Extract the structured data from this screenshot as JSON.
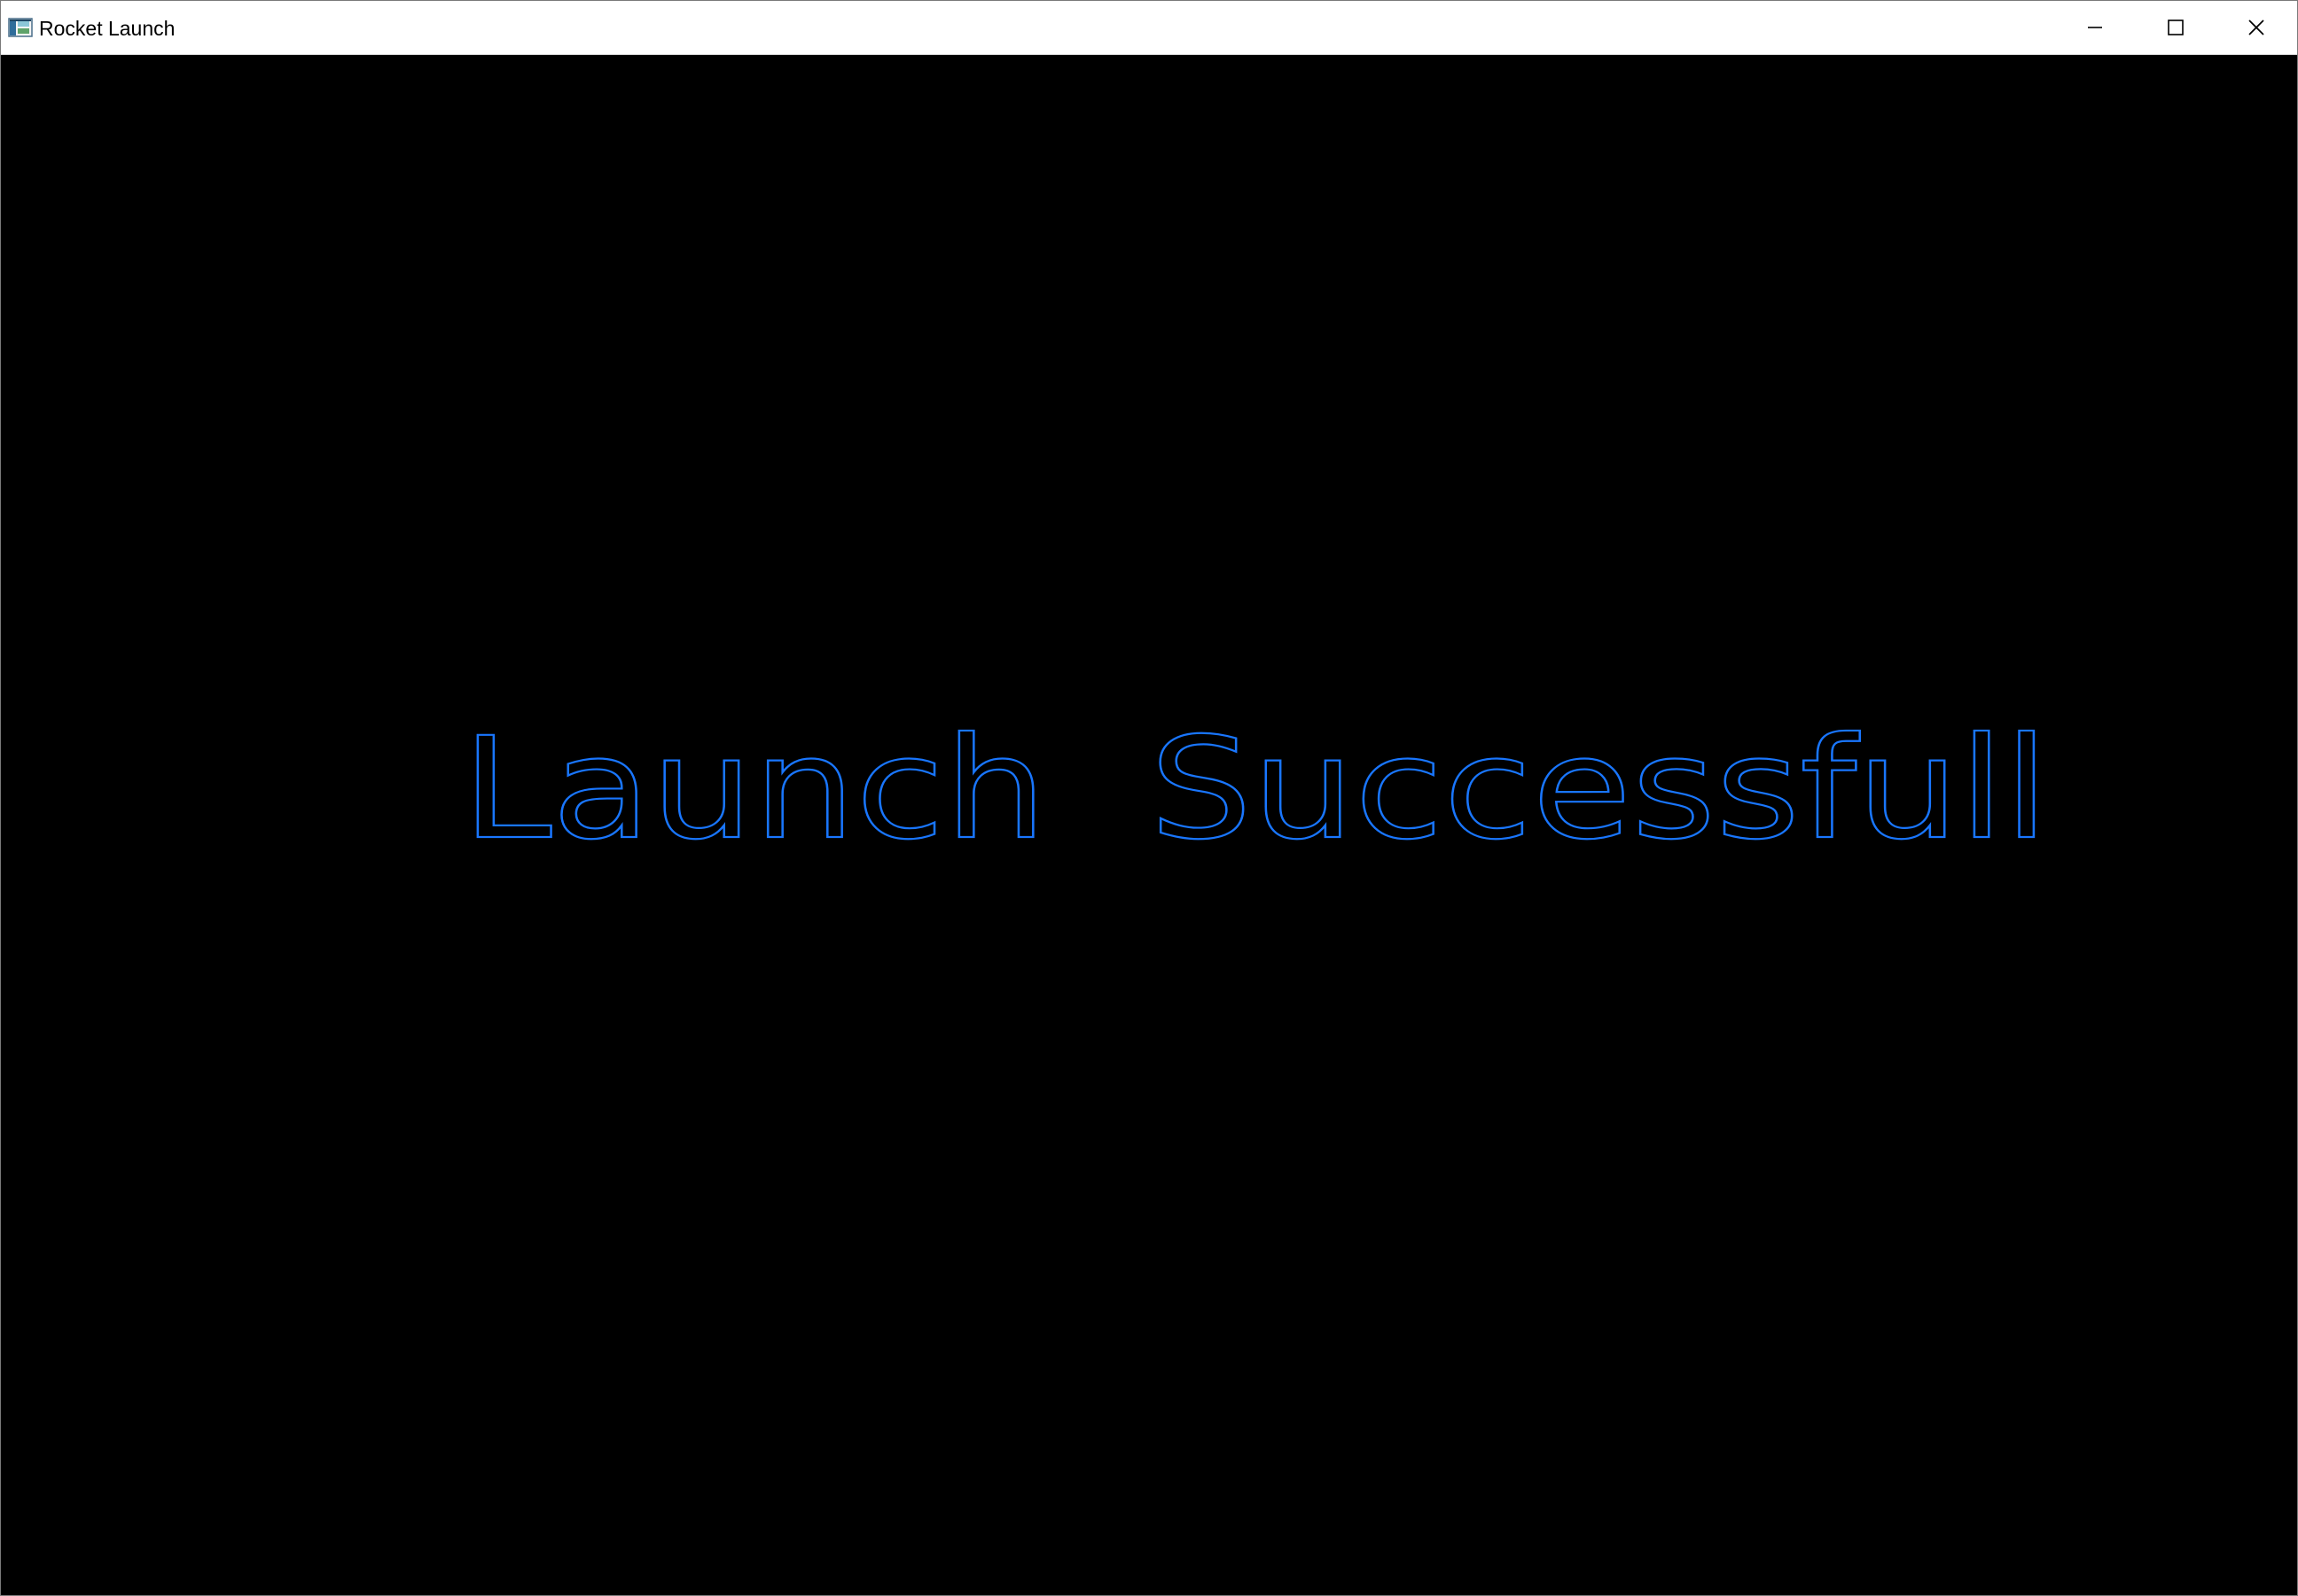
{
  "window": {
    "title": "Rocket Launch",
    "background_color": "#000000",
    "titlebar_color": "#ffffff",
    "icons": {
      "app": "app-window-icon",
      "minimize": "minimize-icon",
      "maximize": "maximize-icon",
      "close": "close-icon"
    }
  },
  "canvas": {
    "message": "Launch  Successfull",
    "message_color": "#1976ff"
  }
}
